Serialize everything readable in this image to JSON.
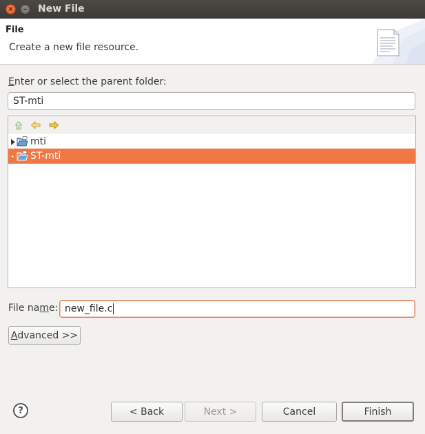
{
  "window": {
    "title": "New File",
    "close_glyph": "×",
    "minimize_glyph": "–"
  },
  "header": {
    "title": "File",
    "description": "Create a new file resource.",
    "graphic_icon": "new-file-wizard-icon"
  },
  "parent_folder": {
    "label_mnemonic": "E",
    "label_rest": "nter or select the parent folder:",
    "value": "ST-mti"
  },
  "tree": {
    "toolbar": {
      "home_icon": "home-icon",
      "back_icon": "back-arrow-icon",
      "forward_icon": "forward-arrow-icon"
    },
    "items": [
      {
        "label": "mti",
        "icon": "project-folder-icon",
        "selected": false
      },
      {
        "label": "ST-mti",
        "icon": "project-folder-icon",
        "selected": true
      }
    ]
  },
  "file_name": {
    "label_before": "File na",
    "label_mnemonic": "m",
    "label_after": "e:",
    "value": "new_file.c"
  },
  "buttons": {
    "advanced_mnemonic": "A",
    "advanced_rest": "dvanced >>",
    "back": "< Back",
    "next": "Next >",
    "cancel": "Cancel",
    "finish": "Finish",
    "help_glyph": "?"
  },
  "colors": {
    "selection": "#f07746",
    "focus_border": "#e87e55",
    "titlebar": "#3c3b37"
  }
}
